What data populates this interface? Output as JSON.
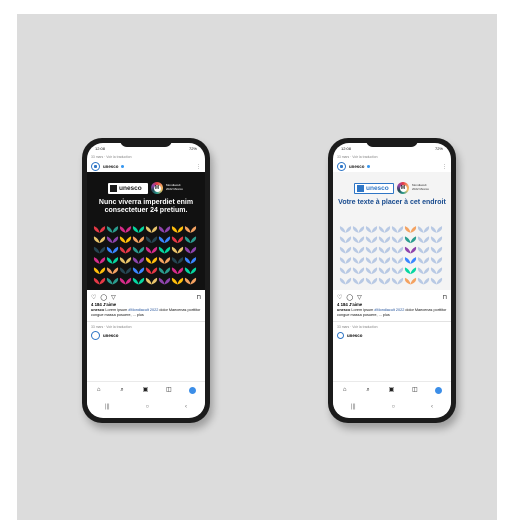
{
  "phones": [
    {
      "variant": "dark",
      "status_time": "12:08",
      "status_battery": "72%",
      "meta": "33 mars · Voir la traduction",
      "account": "unesco",
      "logo_text": "unesco",
      "mondiacult_text": "Mondiacult 2022 México",
      "headline": "Nunc viverra imperdiet enim consectetuer 24 pretium.",
      "likes": "4 184 J'aime",
      "caption_user": "unesco",
      "caption_text": " Lorem ipsum ",
      "caption_tag": "#Mondiacult 2022",
      "caption_rest": " dolor Maecenas porttitor congue massa posuere, ... plus",
      "meta2": "33 mars · Voir la traduction",
      "account2": "unesco"
    },
    {
      "variant": "light",
      "status_time": "12:08",
      "status_battery": "72%",
      "meta": "33 mars · Voir la traduction",
      "account": "unesco",
      "logo_text": "unesco",
      "mondiacult_text": "Mondiacult 2022 México",
      "headline": "Votre texte à placer à cet endroit",
      "likes": "4 184 J'aime",
      "caption_user": "unesco",
      "caption_text": " Lorem ipsum ",
      "caption_tag": "#Mondiacult 2022",
      "caption_rest": " dolor Maecenas porttitor congue massa posuere, ... plus",
      "meta2": "33 mars · Voir la traduction",
      "account2": "unesco"
    }
  ],
  "icons": {
    "like": "♡",
    "comment": "◯",
    "share": "▽",
    "save": "⊓",
    "home": "⌂",
    "search": "⌕",
    "reels": "▣",
    "shop": "◫",
    "back": "‹",
    "recents": "|||",
    "homebtn": "○"
  },
  "colors": {
    "petals": [
      "#e63946",
      "#f4a261",
      "#e9c46a",
      "#2a9d8f",
      "#264653",
      "#8e44ad",
      "#d62c8a",
      "#3a86ff",
      "#ffbe0b",
      "#06d6a0"
    ],
    "light_petal": "#b8c9e4"
  }
}
